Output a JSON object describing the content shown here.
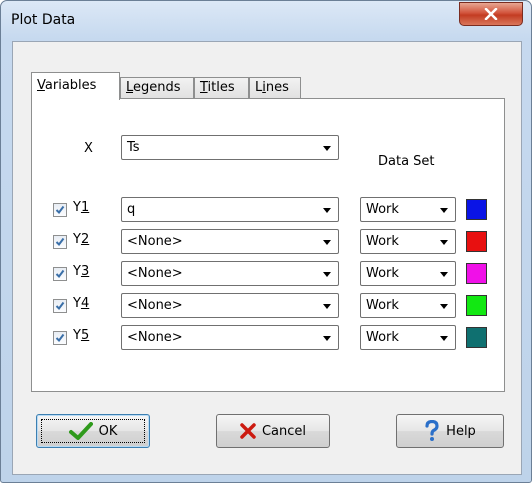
{
  "window": {
    "title": "Plot Data"
  },
  "tabs": [
    {
      "label": "Variables",
      "mnemonic": "V",
      "rest": "ariables"
    },
    {
      "label": "Legends",
      "mnemonic": "L",
      "rest": "egends"
    },
    {
      "label": "Titles",
      "mnemonic": "T",
      "rest": "itles"
    },
    {
      "label": "Lines",
      "prefix": "L",
      "mnemonic": "i",
      "rest": "nes"
    }
  ],
  "x_row": {
    "label": "X",
    "value": "Ts"
  },
  "data_set_header": "Data Set",
  "y_rows": [
    {
      "label_prefix": "Y",
      "label_digit": "1",
      "checked": true,
      "variable": "q",
      "data_set": "Work",
      "color": "#0a14e6"
    },
    {
      "label_prefix": "Y",
      "label_digit": "2",
      "checked": true,
      "variable": "<None>",
      "data_set": "Work",
      "color": "#e81010"
    },
    {
      "label_prefix": "Y",
      "label_digit": "3",
      "checked": true,
      "variable": "<None>",
      "data_set": "Work",
      "color": "#f010e8"
    },
    {
      "label_prefix": "Y",
      "label_digit": "4",
      "checked": true,
      "variable": "<None>",
      "data_set": "Work",
      "color": "#12e812"
    },
    {
      "label_prefix": "Y",
      "label_digit": "5",
      "checked": true,
      "variable": "<None>",
      "data_set": "Work",
      "color": "#0f7070"
    }
  ],
  "buttons": {
    "ok": "OK",
    "cancel": "Cancel",
    "help": "Help"
  }
}
